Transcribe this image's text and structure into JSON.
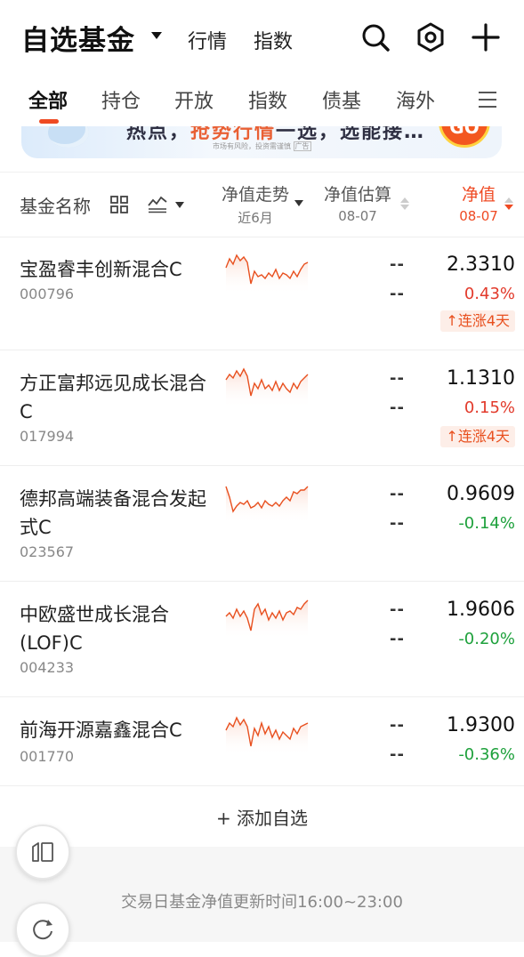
{
  "header": {
    "title": "自选基金",
    "links": [
      "行情",
      "指数"
    ]
  },
  "tabs": [
    "全部",
    "持仓",
    "开放",
    "指数",
    "债基",
    "海外"
  ],
  "banner": {
    "text_pre": "热点，",
    "text_hl": "抢势行情",
    "text_post": "一选，选能接…",
    "sub": "市场有风险，投资需谨慎",
    "sub_tag": "广告",
    "go": "GO"
  },
  "columns": {
    "name": "基金名称",
    "trend": "净值走势",
    "trend_sub": "近6月",
    "estimate": "净值估算",
    "estimate_date": "08-07",
    "nav": "净值",
    "nav_date": "08-07"
  },
  "funds": [
    {
      "name": "宝盈睿丰创新混合C",
      "code": "000796",
      "est": "--",
      "est_pct": "--",
      "nav": "2.3310",
      "pct": "0.43%",
      "streak": "连涨4天"
    },
    {
      "name": "方正富邦远见成长混合C",
      "code": "017994",
      "est": "--",
      "est_pct": "--",
      "nav": "1.1310",
      "pct": "0.15%",
      "streak": "连涨4天"
    },
    {
      "name": "德邦高端装备混合发起式C",
      "code": "023567",
      "est": "--",
      "est_pct": "--",
      "nav": "0.9609",
      "pct": "-0.14%"
    },
    {
      "name": "中欧盛世成长混合(LOF)C",
      "code": "004233",
      "est": "--",
      "est_pct": "--",
      "nav": "1.9606",
      "pct": "-0.20%"
    },
    {
      "name": "前海开源嘉鑫混合C",
      "code": "001770",
      "est": "--",
      "est_pct": "--",
      "nav": "1.9300",
      "pct": "-0.36%"
    }
  ],
  "add_label": "+ 添加自选",
  "footer_note": "交易日基金净值更新时间16:00~23:00",
  "colors": {
    "accent": "#ef4a23",
    "up": "#e23a2b",
    "down": "#1ea13c"
  }
}
